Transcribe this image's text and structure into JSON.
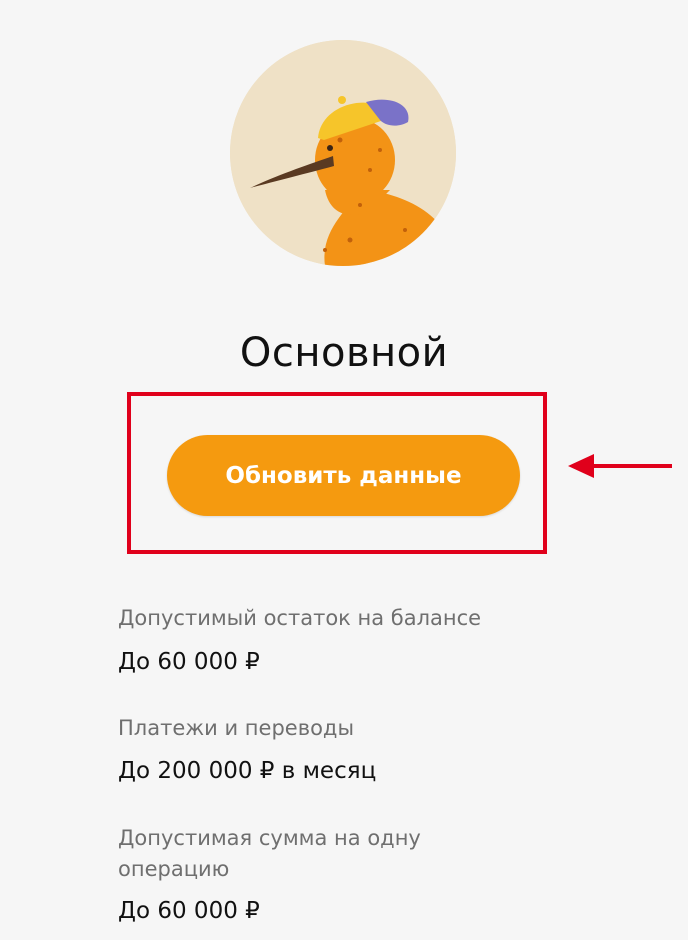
{
  "title": "Основной",
  "update_button": "Обновить данные",
  "limits": [
    {
      "label": "Допустимый остаток на балансе",
      "value": "До 60 000 ₽"
    },
    {
      "label": "Платежи и переводы",
      "value": "До 200 000 ₽ в месяц"
    },
    {
      "label": "Допустимая сумма на одну операцию",
      "value": "До 60 000 ₽"
    }
  ],
  "colors": {
    "accent": "#f59a0f",
    "highlight": "#e0001b",
    "label": "#6f6f6f"
  },
  "icons": {
    "avatar": "kiwi-bird-with-cap-avatar",
    "arrow": "left-arrow-icon"
  }
}
